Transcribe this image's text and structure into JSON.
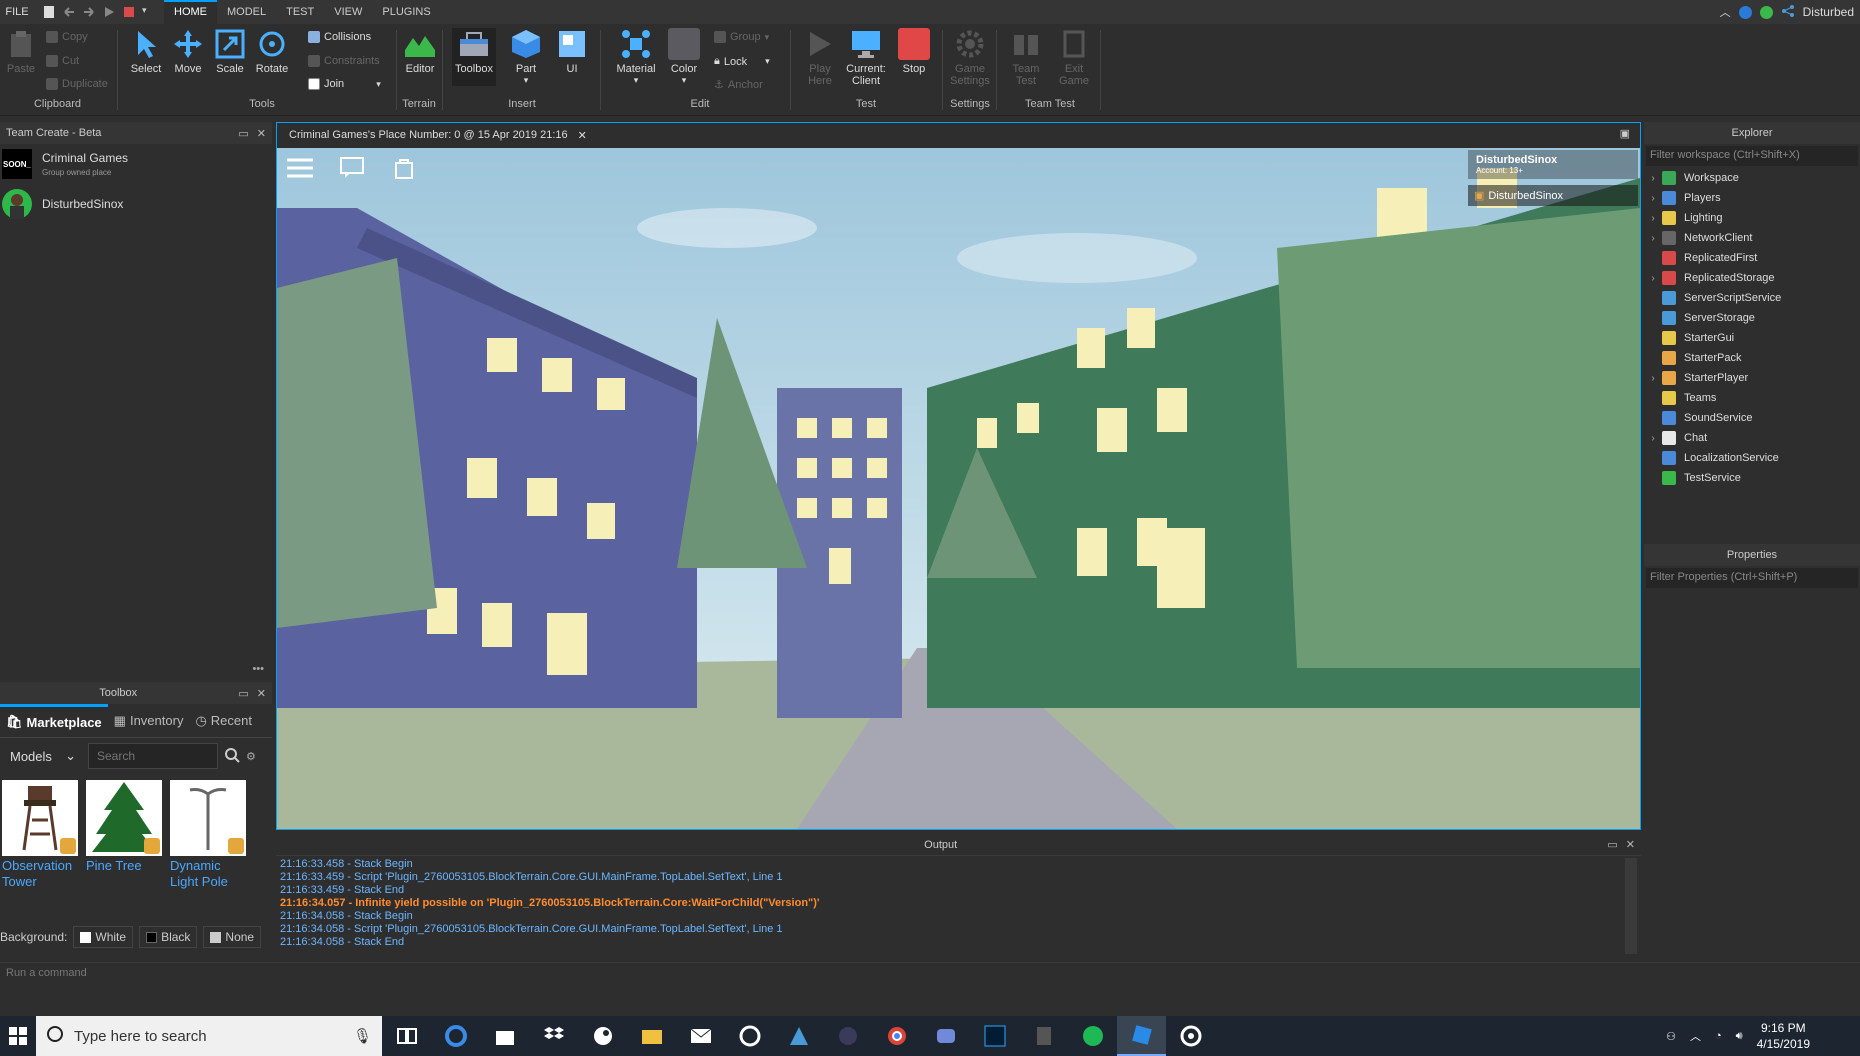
{
  "menubar": {
    "file": "FILE",
    "tabs": [
      "HOME",
      "MODEL",
      "TEST",
      "VIEW",
      "PLUGINS"
    ],
    "user": "Disturbed"
  },
  "ribbon": {
    "clipboard": {
      "paste": "Paste",
      "copy": "Copy",
      "cut": "Cut",
      "duplicate": "Duplicate",
      "label": "Clipboard"
    },
    "tools": {
      "select": "Select",
      "move": "Move",
      "scale": "Scale",
      "rotate": "Rotate",
      "collisions": "Collisions",
      "constraints": "Constraints",
      "join": "Join",
      "label": "Tools"
    },
    "terrain": {
      "editor": "Editor",
      "label": "Terrain"
    },
    "insert": {
      "toolbox": "Toolbox",
      "part": "Part",
      "ui": "UI",
      "label": "Insert"
    },
    "edit": {
      "material": "Material",
      "color": "Color",
      "group": "Group",
      "lock": "Lock",
      "anchor": "Anchor",
      "label": "Edit"
    },
    "test": {
      "play_here": "Play Here",
      "current_client_1": "Current:",
      "current_client_2": "Client",
      "stop": "Stop",
      "label": "Test"
    },
    "settings": {
      "game_settings_1": "Game",
      "game_settings_2": "Settings",
      "label": "Settings"
    },
    "teamtest": {
      "team_test_1": "Team",
      "team_test_2": "Test",
      "exit_game_1": "Exit",
      "exit_game_2": "Game",
      "label": "Team Test"
    }
  },
  "teamcreate": {
    "title": "Team Create - Beta",
    "members": [
      {
        "name": "Criminal Games",
        "sub": "Group owned place",
        "avatar_text": "SOON_"
      },
      {
        "name": "DisturbedSinox",
        "sub": ""
      }
    ]
  },
  "toolbox": {
    "title": "Toolbox",
    "tabs": [
      "Marketplace",
      "Inventory",
      "Recent"
    ],
    "category": "Models",
    "search_placeholder": "Search",
    "items": [
      {
        "label": "Observation Tower"
      },
      {
        "label": "Pine Tree"
      },
      {
        "label": "Dynamic Light Pole"
      }
    ],
    "background_label": "Background:",
    "backgrounds": [
      "White",
      "Black",
      "None"
    ]
  },
  "viewport": {
    "tab_title": "Criminal Games's Place Number: 0 @ 15 Apr 2019 21:16",
    "account_name": "DisturbedSinox",
    "account_sub": "Account: 13+",
    "player": "DisturbedSinox"
  },
  "output": {
    "title": "Output",
    "lines": [
      {
        "text": "21:16:33.458 - Stack Begin",
        "warn": false
      },
      {
        "text": "21:16:33.459 - Script 'Plugin_2760053105.BlockTerrain.Core.GUI.MainFrame.TopLabel.SetText', Line 1",
        "warn": false
      },
      {
        "text": "21:16:33.459 - Stack End",
        "warn": false
      },
      {
        "text": "21:16:34.057 - Infinite yield possible on 'Plugin_2760053105.BlockTerrain.Core:WaitForChild(\"Version\")'",
        "warn": true
      },
      {
        "text": "21:16:34.058 - Stack Begin",
        "warn": false
      },
      {
        "text": "21:16:34.058 - Script 'Plugin_2760053105.BlockTerrain.Core.GUI.MainFrame.TopLabel.SetText', Line 1",
        "warn": false
      },
      {
        "text": "21:16:34.058 - Stack End",
        "warn": false
      }
    ]
  },
  "explorer": {
    "title": "Explorer",
    "filter": "Filter workspace (Ctrl+Shift+X)",
    "items": [
      {
        "label": "Workspace",
        "expand": true,
        "color": "#3aa856"
      },
      {
        "label": "Players",
        "expand": true,
        "color": "#4a8ad8"
      },
      {
        "label": "Lighting",
        "expand": true,
        "color": "#e8c84a"
      },
      {
        "label": "NetworkClient",
        "expand": true,
        "color": "#666666"
      },
      {
        "label": "ReplicatedFirst",
        "expand": false,
        "color": "#d84a4a"
      },
      {
        "label": "ReplicatedStorage",
        "expand": true,
        "color": "#d84a4a"
      },
      {
        "label": "ServerScriptService",
        "expand": false,
        "color": "#4a9ad8"
      },
      {
        "label": "ServerStorage",
        "expand": false,
        "color": "#4a9ad8"
      },
      {
        "label": "StarterGui",
        "expand": false,
        "color": "#e8c84a"
      },
      {
        "label": "StarterPack",
        "expand": false,
        "color": "#e8a84a"
      },
      {
        "label": "StarterPlayer",
        "expand": true,
        "color": "#e8a84a"
      },
      {
        "label": "Teams",
        "expand": false,
        "color": "#e8c84a"
      },
      {
        "label": "SoundService",
        "expand": false,
        "color": "#4a8ad8"
      },
      {
        "label": "Chat",
        "expand": true,
        "color": "#e8e8e8"
      },
      {
        "label": "LocalizationService",
        "expand": false,
        "color": "#4a8ad8"
      },
      {
        "label": "TestService",
        "expand": false,
        "color": "#3ab84a"
      }
    ]
  },
  "properties": {
    "title": "Properties",
    "filter": "Filter Properties (Ctrl+Shift+P)"
  },
  "cmdbar": {
    "placeholder": "Run a command"
  },
  "taskbar": {
    "search_placeholder": "Type here to search",
    "time": "9:16 PM",
    "date": "4/15/2019"
  },
  "colors": {
    "accent": "#00a2ff",
    "output_info": "#6cb6ff",
    "output_warn": "#ff8c2e"
  }
}
